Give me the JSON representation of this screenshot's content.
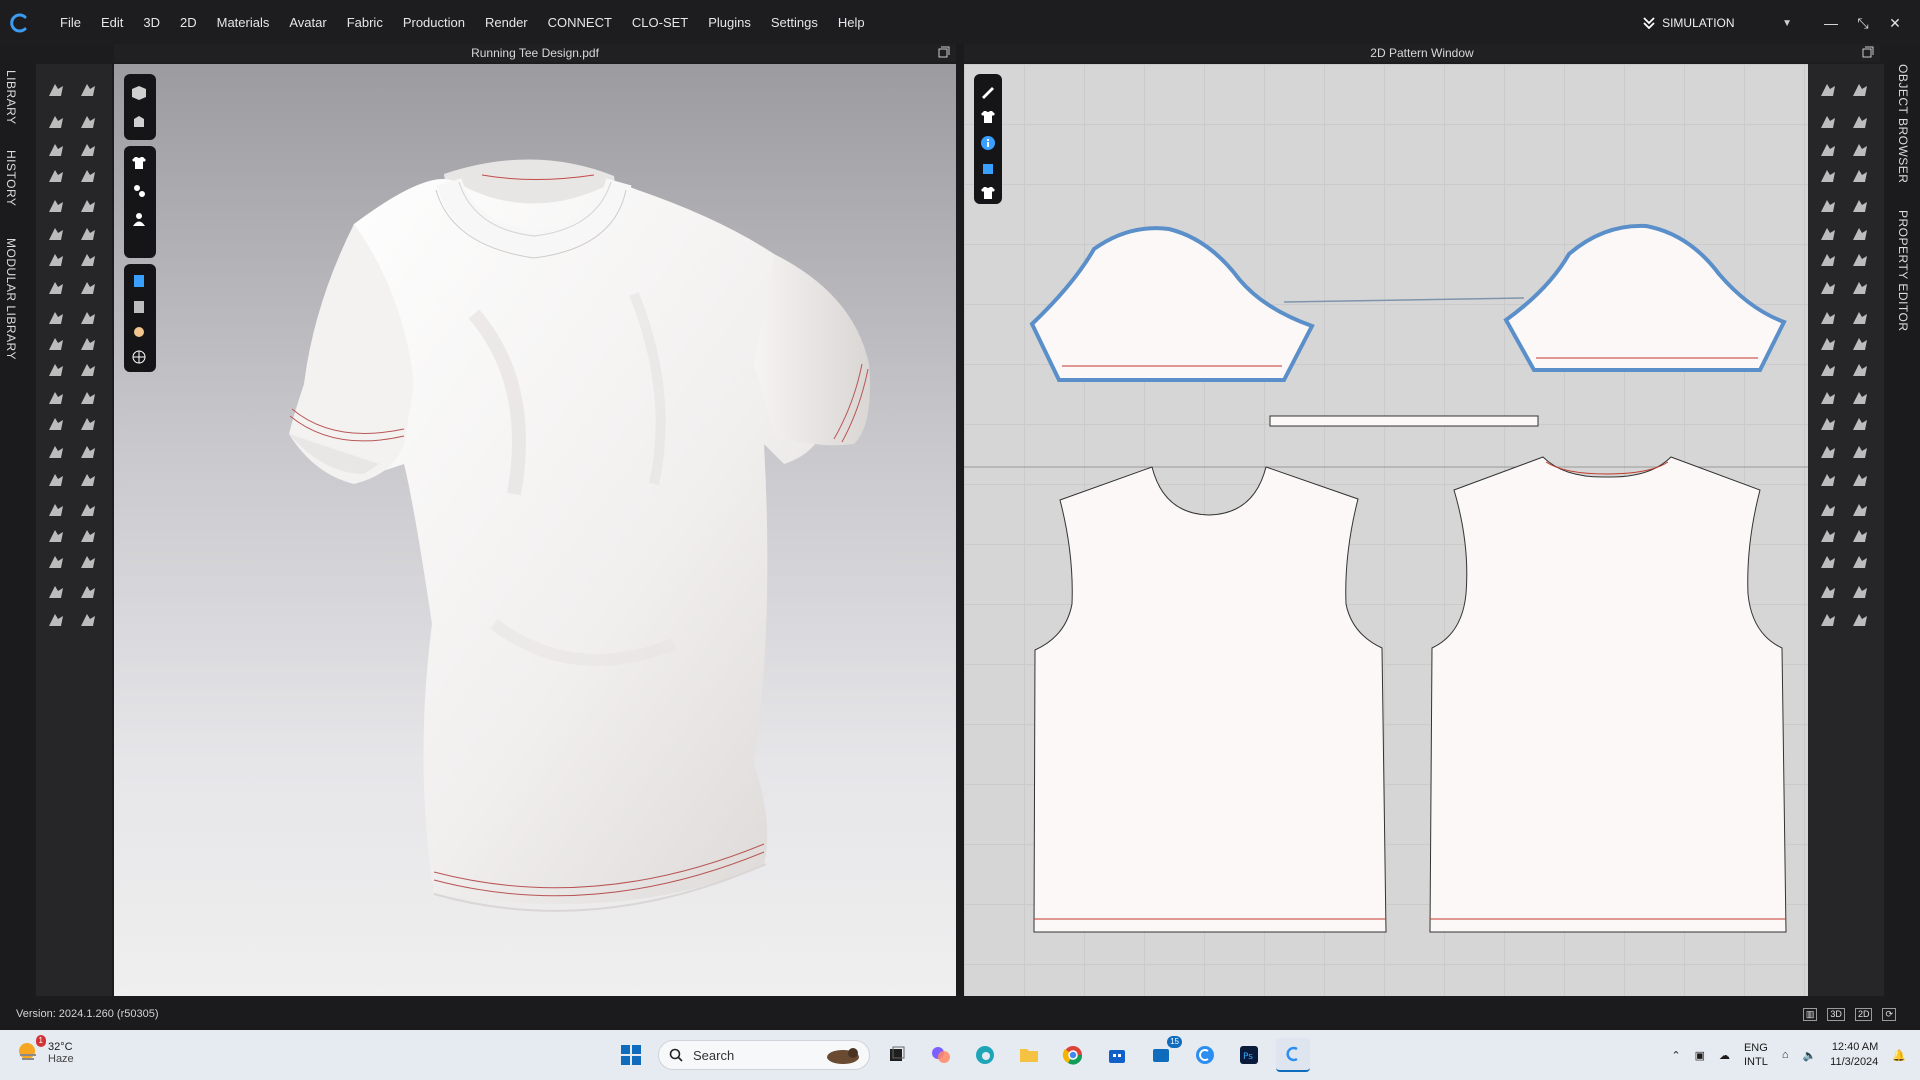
{
  "menu": {
    "items": [
      "File",
      "Edit",
      "3D",
      "2D",
      "Materials",
      "Avatar",
      "Fabric",
      "Production",
      "Render",
      "CONNECT",
      "CLO-SET",
      "Plugins",
      "Settings",
      "Help"
    ],
    "simulation_label": "SIMULATION"
  },
  "side_tabs_left": [
    "LIBRARY",
    "HISTORY",
    "MODULAR LIBRARY"
  ],
  "side_tabs_right": [
    "OBJECT BROWSER",
    "PROPERTY EDITOR"
  ],
  "window_3d": {
    "title": "Running Tee Design.pdf"
  },
  "window_2d": {
    "title": "2D Pattern Window"
  },
  "status": {
    "version": "Version: 2024.1.260 (r50305)",
    "view_modes": [
      "3D",
      "2D"
    ]
  },
  "taskbar": {
    "weather": {
      "temp": "32°C",
      "desc": "Haze",
      "alert_count": "1"
    },
    "search_placeholder": "Search",
    "outlook_badge": "15",
    "lang": {
      "line1": "ENG",
      "line2": "INTL"
    },
    "time": "12:40 AM",
    "date": "11/3/2024"
  },
  "colors": {
    "accent": "#0f6cbd",
    "pattern_outline": "#5b8fc9",
    "stitch": "#c0392b"
  }
}
